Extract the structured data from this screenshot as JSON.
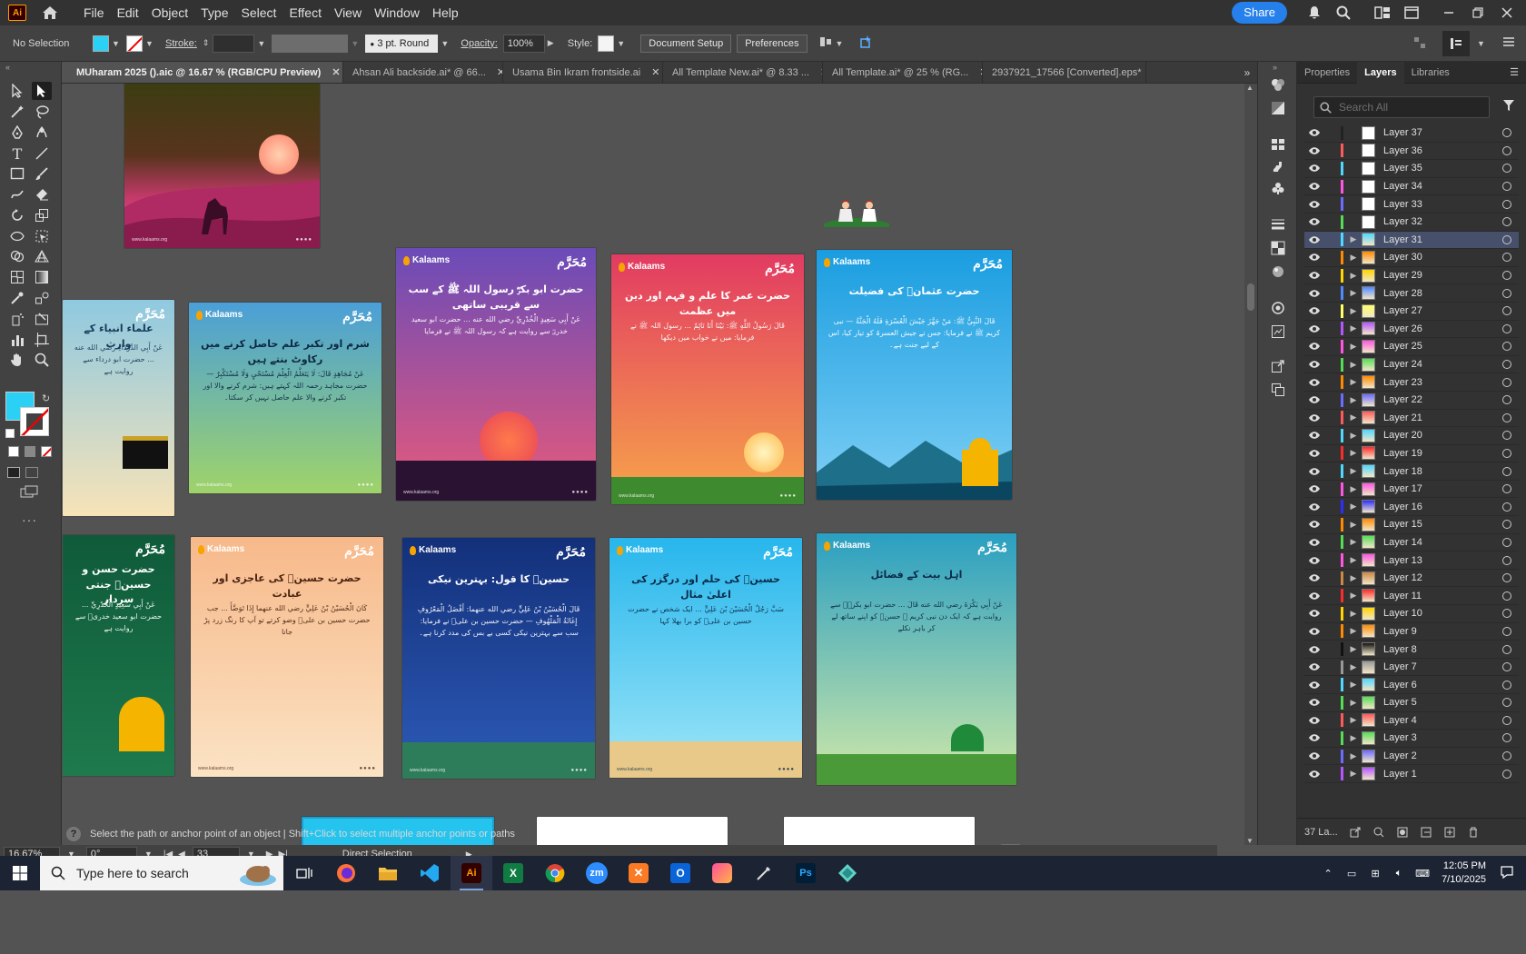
{
  "menu": {
    "app_badge": "Ai",
    "items": [
      "File",
      "Edit",
      "Object",
      "Type",
      "Select",
      "Effect",
      "View",
      "Window",
      "Help"
    ],
    "share_label": "Share"
  },
  "control": {
    "selection": "No Selection",
    "stroke_label": "Stroke:",
    "brush_value": "3 pt. Round",
    "opacity_label": "Opacity:",
    "opacity_value": "100%",
    "style_label": "Style:",
    "document_setup": "Document Setup",
    "preferences": "Preferences",
    "fill_color": "#2ad1f5"
  },
  "tabs": [
    {
      "label": "MUharam 2025 ().aic @ 16.67 % (RGB/CPU Preview)",
      "active": true
    },
    {
      "label": "Ahsan Ali backside.ai* @ 66..."
    },
    {
      "label": "Usama Bin Ikram frontside.ai"
    },
    {
      "label": "All Template New.ai* @ 8.33 ..."
    },
    {
      "label": "All Template.ai* @ 25 % (RG..."
    },
    {
      "label": "2937921_17566 [Converted].eps*"
    }
  ],
  "artboards": {
    "brand": "Kalaams",
    "mark": "مُحَرَّم",
    "footer": "www.kalaams.org",
    "cards": [
      {
        "title": "علماء انبیاء کے وارث",
        "body": "عَنْ أَبِي الدَّرْدَاءِ رضي الله عنه ... حضرت ابو درداء سے روایت ہے",
        "colors": [
          "#8fc9e0",
          "#f7e3b8"
        ]
      },
      {
        "title": "شرم اور تکبر علم حاصل کرنے میں رکاوٹ بنتے ہیں",
        "body": "عَنْ مُجَاهِدٍ قَالَ: لَا يَتَعَلَّمُ الْعِلْمَ مُسْتَحْيٍ وَلَا مُسْتَكْبِرٌ — حضرت مجاہد رحمہ اللہ کہتے ہیں: شرم کرنے والا اور تکبر کرنے والا علم حاصل نہیں کر سکتا۔",
        "colors": [
          "#4a9fd8",
          "#9fd36a"
        ]
      },
      {
        "title": "حضرت ابو بکرؓ رسول اللہ ﷺ کے سب سے قریبی ساتھی",
        "body": "عَنْ أَبِي سَعِيدٍ الْخُدْرِيِّ رضي الله عنه ... حضرت ابو سعید خدریؓ سے روایت ہے کہ رسول اللہ ﷺ نے فرمایا",
        "colors": [
          "#6a4bb8",
          "#e85a7a"
        ]
      },
      {
        "title": "حضرت عمر کا علم و فہم اور دین میں عظمت",
        "body": "قَالَ رَسُولُ اللَّهِ ﷺ: بَيْنَا أَنَا نَائِمٌ ... رسول اللہ ﷺ نے فرمایا: میں نے خواب میں دیکھا",
        "colors": [
          "#e23b62",
          "#f7a54a"
        ]
      },
      {
        "title": "حضرت عثمانؓ کی فضیلت",
        "body": "قَالَ النَّبِيُّ ﷺ: مَنْ جَهَّزَ جَيْشَ الْعُسْرَةِ فَلَهُ الْجَنَّةُ — نبی کریم ﷺ نے فرمایا: جس نے جیش العسرۃ کو تیار کیا، اس کے لیے جنت ہے۔",
        "colors": [
          "#1a9de0",
          "#7fd0f5"
        ]
      },
      {
        "title": "حضرت حسن و حسینؓ جنتی سردار",
        "body": "عَنْ أَبِي سَعِيدٍ الْخُدْرِيِّ ... حضرت ابو سعید خدریؓ سے روایت ہے",
        "colors": [
          "#0f5a3a",
          "#1e7a4c"
        ]
      },
      {
        "title": "حضرت حسینؓ کی عاجزی اور عبادت",
        "body": "كَانَ الْحُسَيْنُ بْنُ عَلِيٍّ رضي الله عنهما إِذَا تَوَضَّأَ ... جب حضرت حسین بن علیؓ وضو کرتے تو آپ کا رنگ زرد پڑ جاتا",
        "colors": [
          "#f7b98a",
          "#fbe3c4"
        ]
      },
      {
        "title": "حسینؓ کا قول: بہترین نیکی",
        "body": "قَالَ الْحُسَيْنُ بْنُ عَلِيٍّ رضي الله عنهما: أَفْضَلُ الْمَعْرُوفِ إِغَاثَةُ الْمَلْهُوفِ — حضرت حسین بن علیؓ نے فرمایا: سب سے بہترین نیکی کسی بے بس کی مدد کرنا ہے۔",
        "colors": [
          "#13307a",
          "#2d5bb8"
        ]
      },
      {
        "title": "حسینؓ کی حلم اور درگزر کی اعلیٰ مثال",
        "body": "سَبَّ رَجُلٌ الْحُسَيْنَ بْنَ عَلِيٍّ ... ایک شخص نے حضرت حسین بن علیؓ کو برا بھلا کہا",
        "colors": [
          "#27b6ec",
          "#9ee6f8"
        ]
      },
      {
        "title": "اہل بیت کے فضائل",
        "body": "عَنْ أَبِي بَكْرَةَ رضي الله عنه قَالَ ... حضرت ابو بکرہؓ سے روایت ہے کہ ایک دن نبی کریم ﷺ حسنؓ کو اپنے ساتھ لے کر باہر نکلے",
        "colors": [
          "#2a9fc2",
          "#cfe8a8"
        ]
      }
    ]
  },
  "panel": {
    "tabs": [
      "Properties",
      "Layers",
      "Libraries"
    ],
    "search_placeholder": "Search All",
    "layers": [
      {
        "name": "Layer 37",
        "color": "#222222"
      },
      {
        "name": "Layer 36",
        "color": "#ff5a5a"
      },
      {
        "name": "Layer 35",
        "color": "#4fd7ff"
      },
      {
        "name": "Layer 34",
        "color": "#ff55e2"
      },
      {
        "name": "Layer 33",
        "color": "#6b6bff"
      },
      {
        "name": "Layer 32",
        "color": "#55dd55"
      },
      {
        "name": "Layer 31",
        "color": "#4fd7ff",
        "selected": true
      },
      {
        "name": "Layer 30",
        "color": "#ff8a00"
      },
      {
        "name": "Layer 29",
        "color": "#ffd400"
      },
      {
        "name": "Layer 28",
        "color": "#4f8aff"
      },
      {
        "name": "Layer 27",
        "color": "#ffff66"
      },
      {
        "name": "Layer 26",
        "color": "#b455ff"
      },
      {
        "name": "Layer 25",
        "color": "#ff55e2"
      },
      {
        "name": "Layer 24",
        "color": "#55dd55"
      },
      {
        "name": "Layer 23",
        "color": "#ff8a00"
      },
      {
        "name": "Layer 22",
        "color": "#6b6bff"
      },
      {
        "name": "Layer 21",
        "color": "#ff5a5a"
      },
      {
        "name": "Layer 20",
        "color": "#4fd7ff"
      },
      {
        "name": "Layer 19",
        "color": "#ff2a2a"
      },
      {
        "name": "Layer 18",
        "color": "#4fd7ff"
      },
      {
        "name": "Layer 17",
        "color": "#ff55e2"
      },
      {
        "name": "Layer 16",
        "color": "#2e2eff"
      },
      {
        "name": "Layer 15",
        "color": "#ff8a00"
      },
      {
        "name": "Layer 14",
        "color": "#55dd55"
      },
      {
        "name": "Layer 13",
        "color": "#ff55e2"
      },
      {
        "name": "Layer 12",
        "color": "#cc8844"
      },
      {
        "name": "Layer 11",
        "color": "#ff2a2a"
      },
      {
        "name": "Layer 10",
        "color": "#ffd400"
      },
      {
        "name": "Layer 9",
        "color": "#ff8a00"
      },
      {
        "name": "Layer 8",
        "color": "#111111"
      },
      {
        "name": "Layer 7",
        "color": "#999999"
      },
      {
        "name": "Layer 6",
        "color": "#4fd7ff"
      },
      {
        "name": "Layer 5",
        "color": "#55dd55"
      },
      {
        "name": "Layer 4",
        "color": "#ff5a5a"
      },
      {
        "name": "Layer 3",
        "color": "#55dd55"
      },
      {
        "name": "Layer 2",
        "color": "#6b6bff"
      },
      {
        "name": "Layer 1",
        "color": "#b455ff"
      }
    ],
    "layer_count": "37 La..."
  },
  "status": {
    "hint_text": "Select the path or anchor point of an object  |  Shift+Click to select multiple anchor points or paths",
    "zoom": "16.67%",
    "rotation": "0°",
    "artboard_num": "33",
    "tool_name": "Direct Selection"
  },
  "taskbar": {
    "search_placeholder": "Type here to search",
    "time": "12:05 PM",
    "date": "7/10/2025"
  }
}
